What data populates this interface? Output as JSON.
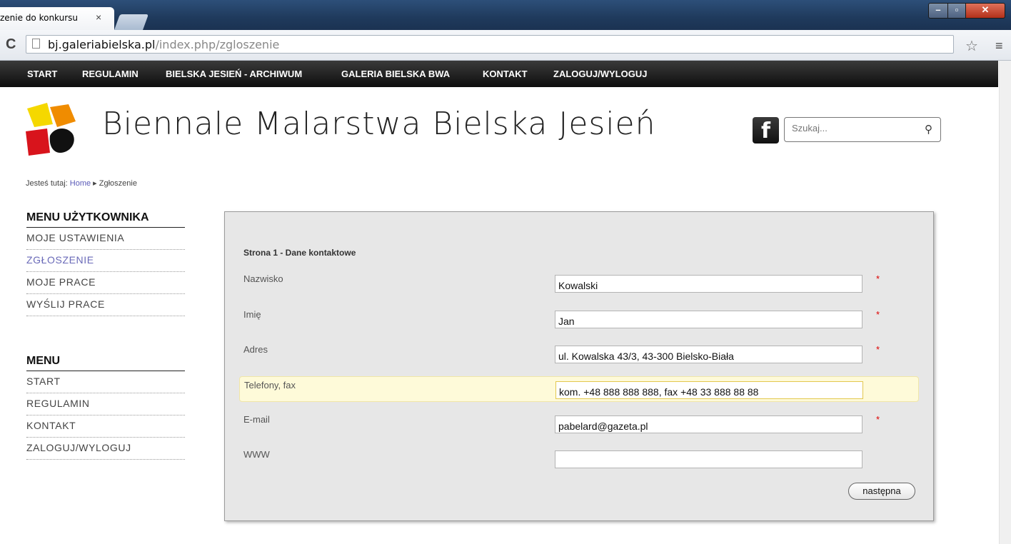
{
  "browser": {
    "tab_title": "zenie do konkursu",
    "tab_close": "×",
    "url_host": "bj.galeriabielska.pl",
    "url_path": "/index.php/zgloszenie",
    "reload_glyph": "C",
    "star_glyph": "☆",
    "menu_glyph": "≡"
  },
  "topnav": [
    "START",
    "REGULAMIN",
    "BIELSKA JESIEŃ - ARCHIWUM",
    "GALERIA BIELSKA BWA",
    "KONTAKT",
    "ZALOGUJ/WYLOGUJ"
  ],
  "site": {
    "title": "Biennale Malarstwa Bielska Jesień",
    "facebook": "f",
    "search_placeholder": "Szukaj...",
    "search_glyph": "🔍"
  },
  "breadcrumb": {
    "prefix": "Jesteś tutaj:",
    "home": "Home",
    "separator": "▸",
    "current": "Zgłoszenie"
  },
  "user_menu": {
    "title": "MENU UŻYTKOWNIKA",
    "items": [
      "MOJE USTAWIENIA",
      "ZGŁOSZENIE",
      "MOJE PRACE",
      "WYŚLIJ PRACE"
    ],
    "active_index": 1
  },
  "main_menu": {
    "title": "MENU",
    "items": [
      "START",
      "REGULAMIN",
      "KONTAKT",
      "ZALOGUJ/WYLOGUJ"
    ]
  },
  "form": {
    "page_title": "Strona 1 - Dane kontaktowe",
    "fields": [
      {
        "label": "Nazwisko",
        "value": "Kowalski",
        "required": true
      },
      {
        "label": "Imię",
        "value": "Jan",
        "required": true
      },
      {
        "label": "Adres",
        "value": "ul. Kowalska 43/3, 43-300 Bielsko-Biała",
        "required": true
      },
      {
        "label": "Telefony, fax",
        "value": "kom. +48 888 888 888, fax +48 33 888 88 88",
        "required": false,
        "focused": true
      },
      {
        "label": "E-mail",
        "value": "pabelard@gazeta.pl",
        "required": true
      },
      {
        "label": "WWW",
        "value": "",
        "required": false
      }
    ],
    "required_mark": "*",
    "next_button": "następna"
  },
  "colors": {
    "nav_bg": "#111111",
    "link": "#5b5bb8",
    "active_menu": "#6a6ab8",
    "panel_bg": "#e7e7e7",
    "highlight_row": "#fefad9",
    "required": "#dd0000",
    "logo_yellow": "#f5d800",
    "logo_orange": "#f08c00",
    "logo_red": "#d8141c",
    "logo_black": "#111111"
  }
}
